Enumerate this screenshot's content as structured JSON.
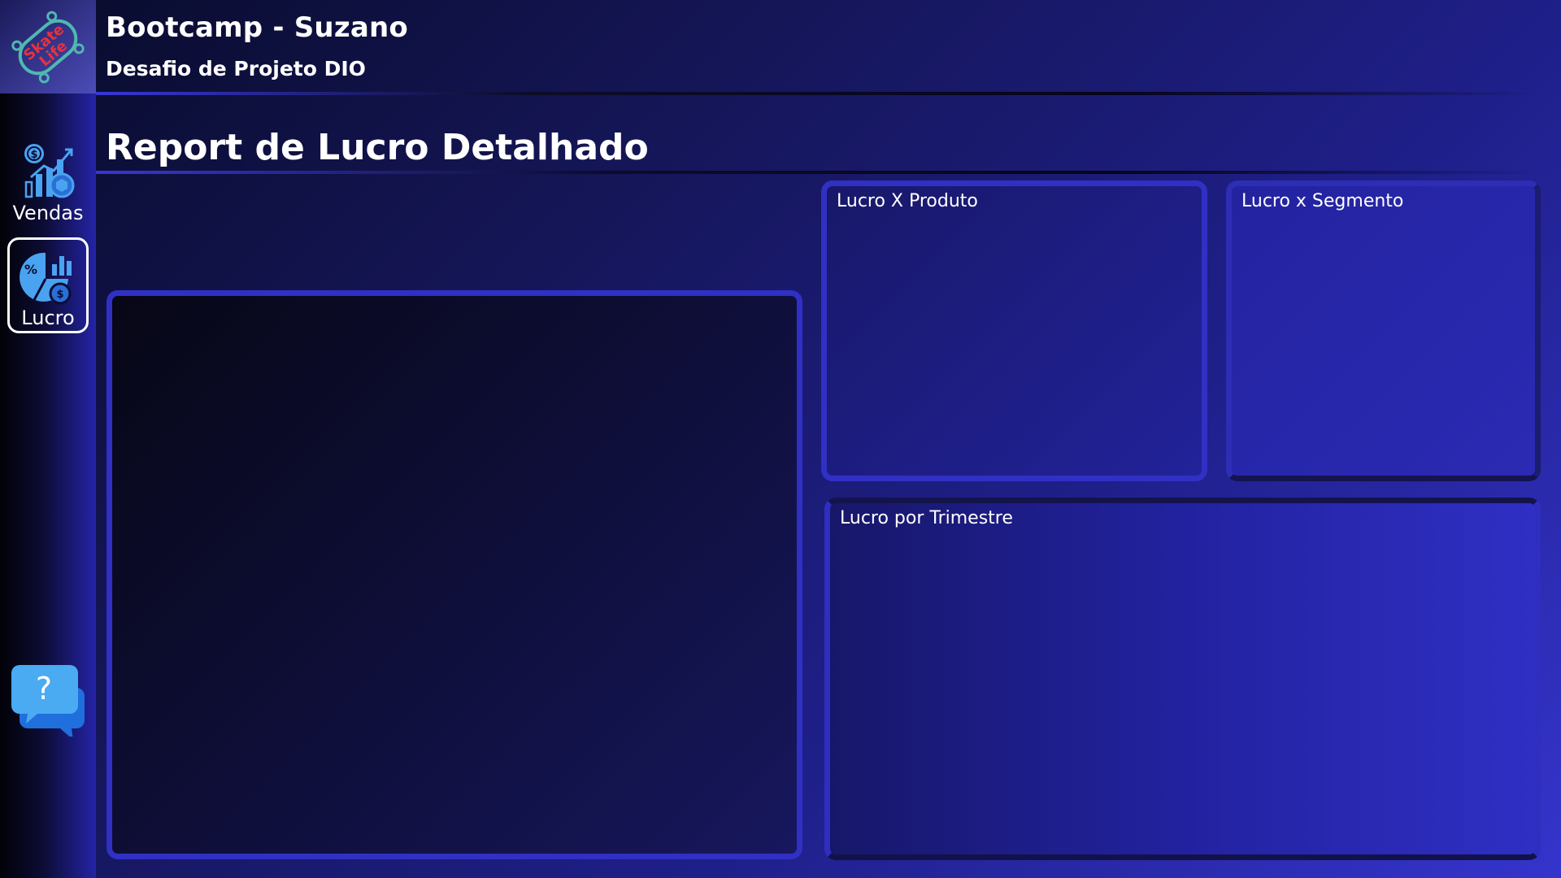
{
  "header": {
    "title": "Bootcamp - Suzano",
    "subtitle": "Desafio de Projeto DIO"
  },
  "logo": {
    "text_line1": "Skate",
    "text_line2": "Life"
  },
  "sidebar": {
    "items": [
      {
        "label": "Vendas",
        "icon": "sales-chart-icon"
      },
      {
        "label": "Lucro",
        "icon": "profit-pie-icon",
        "active": true
      }
    ],
    "help_icon": "help-chat-icon"
  },
  "page": {
    "title": "Report de Lucro Detalhado"
  },
  "panels": {
    "main": {
      "label": ""
    },
    "produto": {
      "label": "Lucro X Produto"
    },
    "segmento": {
      "label": "Lucro x Segmento"
    },
    "trimestre": {
      "label": "Lucro por Trimestre"
    }
  },
  "colors": {
    "accent": "#3030c4",
    "active_border": "#ffffff",
    "icon_blue": "#4aa3f0",
    "logo_red": "#e8323c",
    "logo_teal": "#4fb8b0"
  }
}
